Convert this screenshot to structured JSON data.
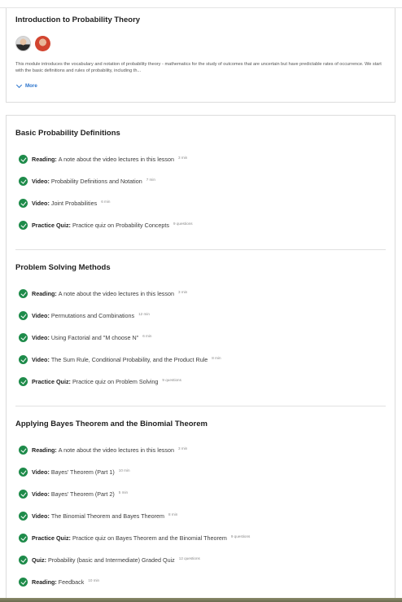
{
  "intro": {
    "title": "Introduction to Probability Theory",
    "description": "This module introduces the vocabulary and notation of probability theory - mathematics for the study of outcomes that are uncertain but have predictable rates of occurrence. We start with the basic definitions and rules of probability, including th...",
    "more_label": "More"
  },
  "sections": [
    {
      "title": "Basic Probability Definitions",
      "items": [
        {
          "type": "Reading:",
          "text": "A note about the video lectures in this lesson",
          "meta": "3 min"
        },
        {
          "type": "Video:",
          "text": "Probability Definitions and Notation",
          "meta": "7 min"
        },
        {
          "type": "Video:",
          "text": "Joint Probabilities",
          "meta": "6 min"
        },
        {
          "type": "Practice Quiz:",
          "text": "Practice quiz on Probability Concepts",
          "meta": "9 questions"
        }
      ]
    },
    {
      "title": "Problem Solving Methods",
      "items": [
        {
          "type": "Reading:",
          "text": "A note about the video lectures in this lesson",
          "meta": "3 min"
        },
        {
          "type": "Video:",
          "text": "Permutations and Combinations",
          "meta": "12 min"
        },
        {
          "type": "Video:",
          "text": "Using Factorial and \"M choose N\"",
          "meta": "6 min"
        },
        {
          "type": "Video:",
          "text": "The Sum Rule, Conditional Probability, and the Product Rule",
          "meta": "8 min"
        },
        {
          "type": "Practice Quiz:",
          "text": "Practice quiz on Problem Solving",
          "meta": "9 questions"
        }
      ]
    },
    {
      "title": "Applying Bayes Theorem and the Binomial Theorem",
      "items": [
        {
          "type": "Reading:",
          "text": "A note about the video lectures in this lesson",
          "meta": "3 min"
        },
        {
          "type": "Video:",
          "text": "Bayes' Theorem (Part 1)",
          "meta": "10 min"
        },
        {
          "type": "Video:",
          "text": "Bayes' Theorem (Part 2)",
          "meta": "5 min"
        },
        {
          "type": "Video:",
          "text": "The Binomial Theorem and Bayes Theorem",
          "meta": "8 min"
        },
        {
          "type": "Practice Quiz:",
          "text": "Practice quiz on Bayes Theorem and the Binomial Theorem",
          "meta": "9 questions"
        },
        {
          "type": "Quiz:",
          "text": "Probability (basic and Intermediate) Graded Quiz",
          "meta": "12 questions"
        },
        {
          "type": "Reading:",
          "text": "Feedback",
          "meta": "10 min"
        }
      ]
    }
  ]
}
